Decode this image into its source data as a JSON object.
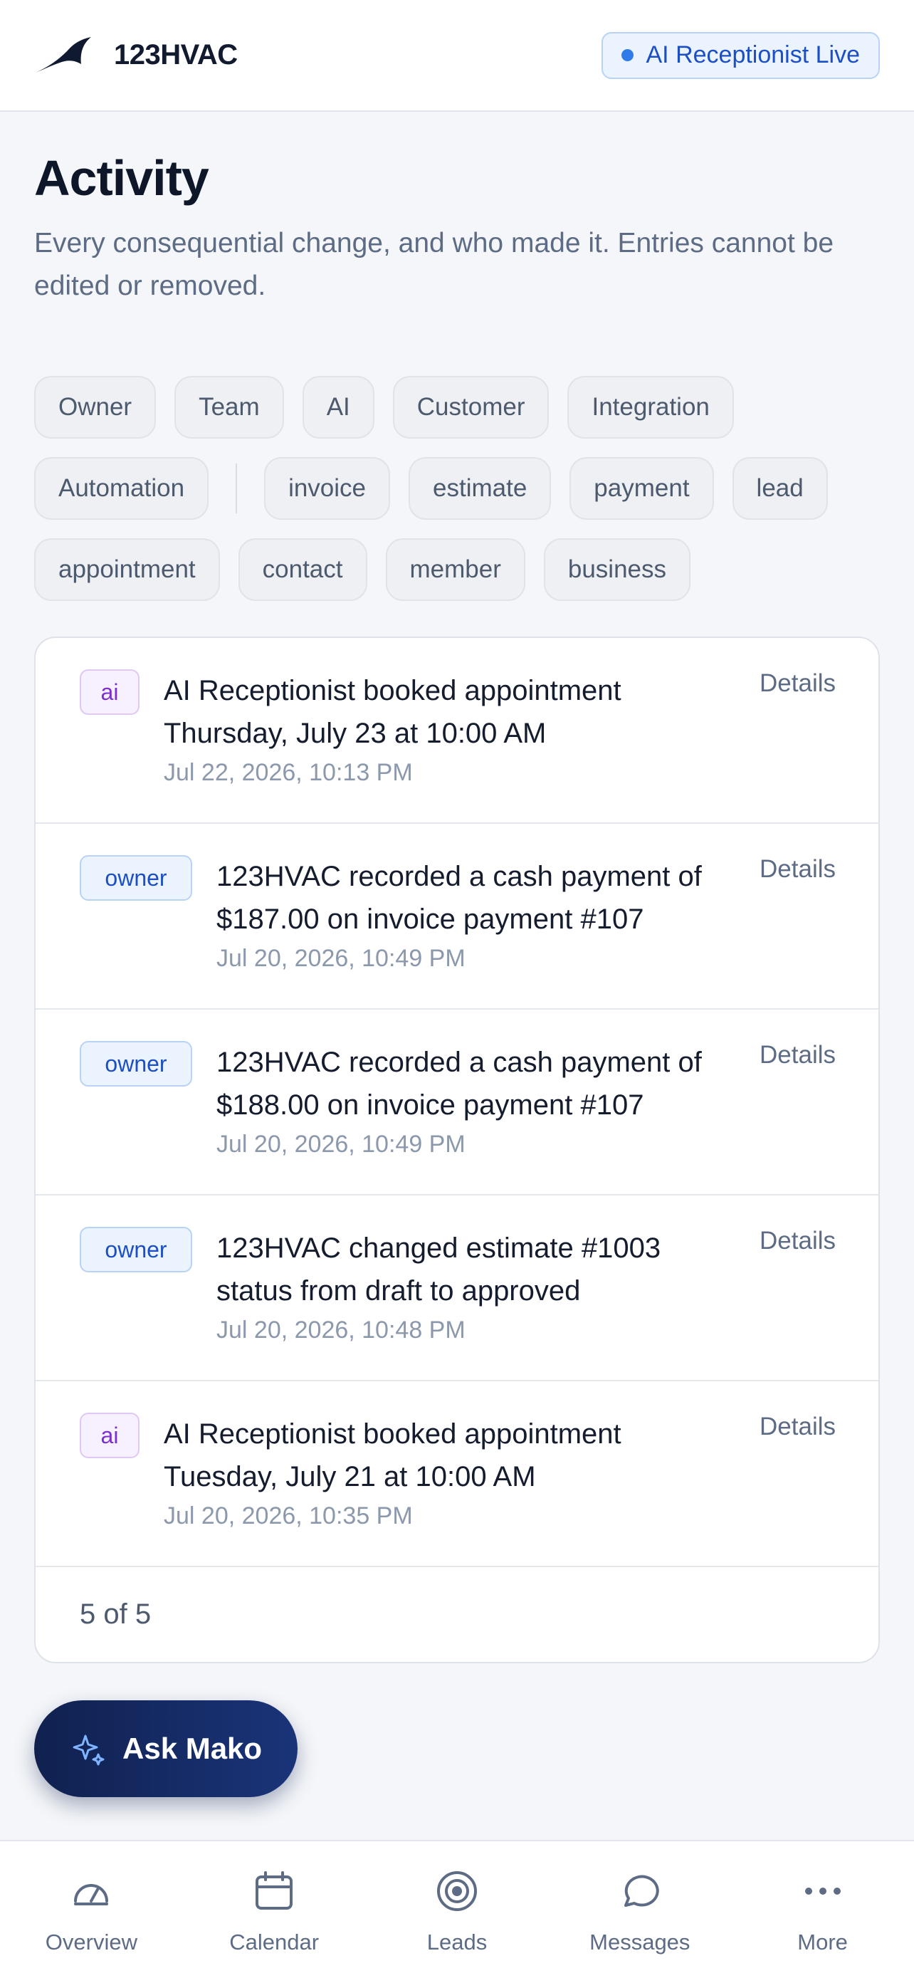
{
  "header": {
    "brand_name": "123HVAC",
    "status_badge": "AI Receptionist Live"
  },
  "page": {
    "title": "Activity",
    "subtitle": "Every consequential change, and who made it. Entries cannot be edited or removed."
  },
  "filters": {
    "actors": [
      "Owner",
      "Team",
      "AI",
      "Customer",
      "Integration",
      "Automation"
    ],
    "entities": [
      "invoice",
      "estimate",
      "payment",
      "lead",
      "appointment",
      "contact",
      "member",
      "business"
    ]
  },
  "entries": [
    {
      "tag": "ai",
      "text": "AI Receptionist booked appointment Thursday, July 23 at 10:00 AM",
      "time": "Jul 22, 2026, 10:13 PM",
      "details": "Details"
    },
    {
      "tag": "owner",
      "text": "123HVAC recorded a cash payment of $187.00 on invoice payment #107",
      "time": "Jul 20, 2026, 10:49 PM",
      "details": "Details"
    },
    {
      "tag": "owner",
      "text": "123HVAC recorded a cash payment of $188.00 on invoice payment #107",
      "time": "Jul 20, 2026, 10:49 PM",
      "details": "Details"
    },
    {
      "tag": "owner",
      "text": "123HVAC changed estimate #1003 status from draft to approved",
      "time": "Jul 20, 2026, 10:48 PM",
      "details": "Details"
    },
    {
      "tag": "ai",
      "text": "AI Receptionist booked appointment Tuesday, July 21 at 10:00 AM",
      "time": "Jul 20, 2026, 10:35 PM",
      "details": "Details"
    }
  ],
  "pagination": {
    "count_label": "5 of 5"
  },
  "assistant": {
    "label": "Ask Mako",
    "icon": "sparkle-icon"
  },
  "nav": [
    {
      "label": "Overview",
      "icon": "gauge-icon"
    },
    {
      "label": "Calendar",
      "icon": "calendar-icon"
    },
    {
      "label": "Leads",
      "icon": "target-icon"
    },
    {
      "label": "Messages",
      "icon": "chat-bubble-icon"
    },
    {
      "label": "More",
      "icon": "more-dots-icon"
    }
  ],
  "colors": {
    "accent": "#1d4fc4",
    "ai_tag": "#7b2fd0",
    "assistant_button": "#10214f",
    "live_dot": "#2f7be8"
  }
}
